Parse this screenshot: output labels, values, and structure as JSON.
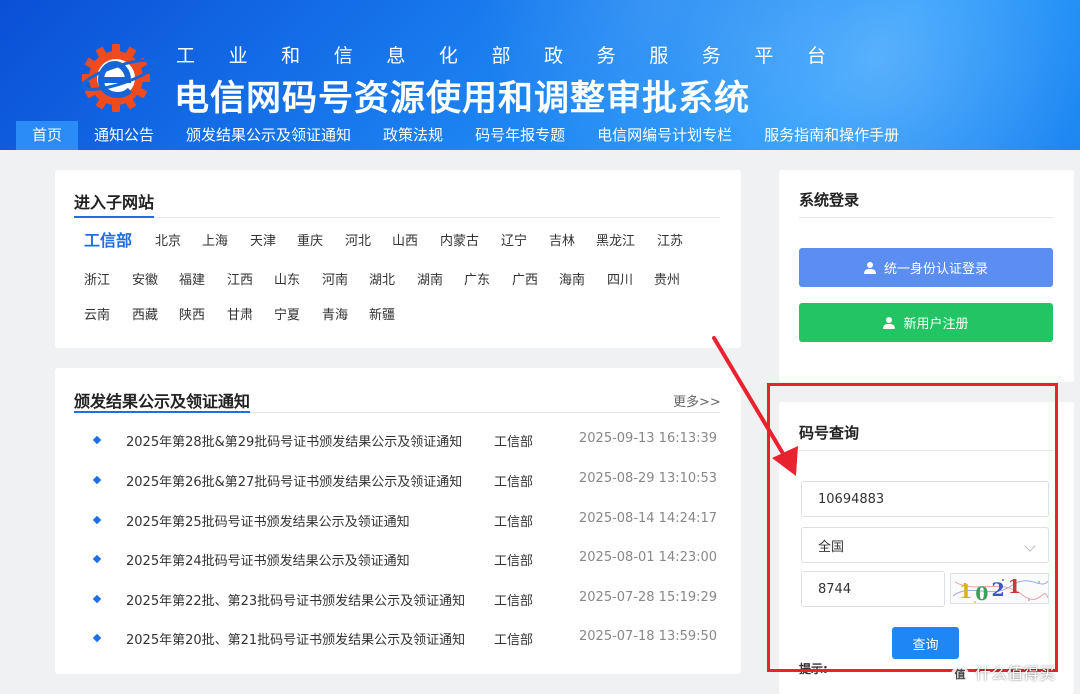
{
  "header": {
    "org_name_chars": [
      "工",
      "业",
      "和",
      "信",
      "息",
      "化",
      "部",
      "政",
      "务",
      "服",
      "务",
      "平",
      "台"
    ],
    "system_name": "电信网码号资源使用和调整审批系统"
  },
  "nav": {
    "items": [
      {
        "label": "首页",
        "active": true
      },
      {
        "label": "通知公告"
      },
      {
        "label": "颁发结果公示及领证通知"
      },
      {
        "label": "政策法规"
      },
      {
        "label": "码号年报专题"
      },
      {
        "label": "电信网编号计划专栏"
      },
      {
        "label": "服务指南和操作手册"
      }
    ]
  },
  "subsites": {
    "title": "进入子网站",
    "primary": "工信部",
    "rows": [
      [
        "北京",
        "上海",
        "天津",
        "重庆",
        "河北",
        "山西",
        "内蒙古",
        "辽宁",
        "吉林",
        "黑龙江",
        "江苏"
      ],
      [
        "浙江",
        "安徽",
        "福建",
        "江西",
        "山东",
        "河南",
        "湖北",
        "湖南",
        "广东",
        "广西",
        "海南",
        "四川",
        "贵州"
      ],
      [
        "云南",
        "西藏",
        "陕西",
        "甘肃",
        "宁夏",
        "青海",
        "新疆"
      ]
    ]
  },
  "news": {
    "title": "颁发结果公示及领证通知",
    "more": "更多>>",
    "items": [
      {
        "title": "2025年第28批&第29批码号证书颁发结果公示及领证通知",
        "source": "工信部",
        "date": "2025-09-13 16:13:39"
      },
      {
        "title": "2025年第26批&第27批码号证书颁发结果公示及领证通知",
        "source": "工信部",
        "date": "2025-08-29 13:10:53"
      },
      {
        "title": "2025年第25批码号证书颁发结果公示及领证通知",
        "source": "工信部",
        "date": "2025-08-14 14:24:17"
      },
      {
        "title": "2025年第24批码号证书颁发结果公示及领证通知",
        "source": "工信部",
        "date": "2025-08-01 14:23:00"
      },
      {
        "title": "2025年第22批、第23批码号证书颁发结果公示及领证通知",
        "source": "工信部",
        "date": "2025-07-28 15:19:29"
      },
      {
        "title": "2025年第20批、第21批码号证书颁发结果公示及领证通知",
        "source": "工信部",
        "date": "2025-07-18 13:59:50"
      }
    ]
  },
  "login": {
    "title": "系统登录",
    "unified_login": "统一身份认证登录",
    "register": "新用户注册",
    "login_color": "#5b8ef0",
    "register_color": "#22c463"
  },
  "query": {
    "title": "码号查询",
    "number_value": "10694883",
    "region_value": "全国",
    "captcha_value": "8744",
    "captcha_text": "1021",
    "submit": "查询",
    "hint": "提示:"
  },
  "watermark": {
    "mark": "值",
    "text": "什么值得买"
  },
  "colors": {
    "accent": "#1e6fe6",
    "annotation": "#e8232f"
  }
}
